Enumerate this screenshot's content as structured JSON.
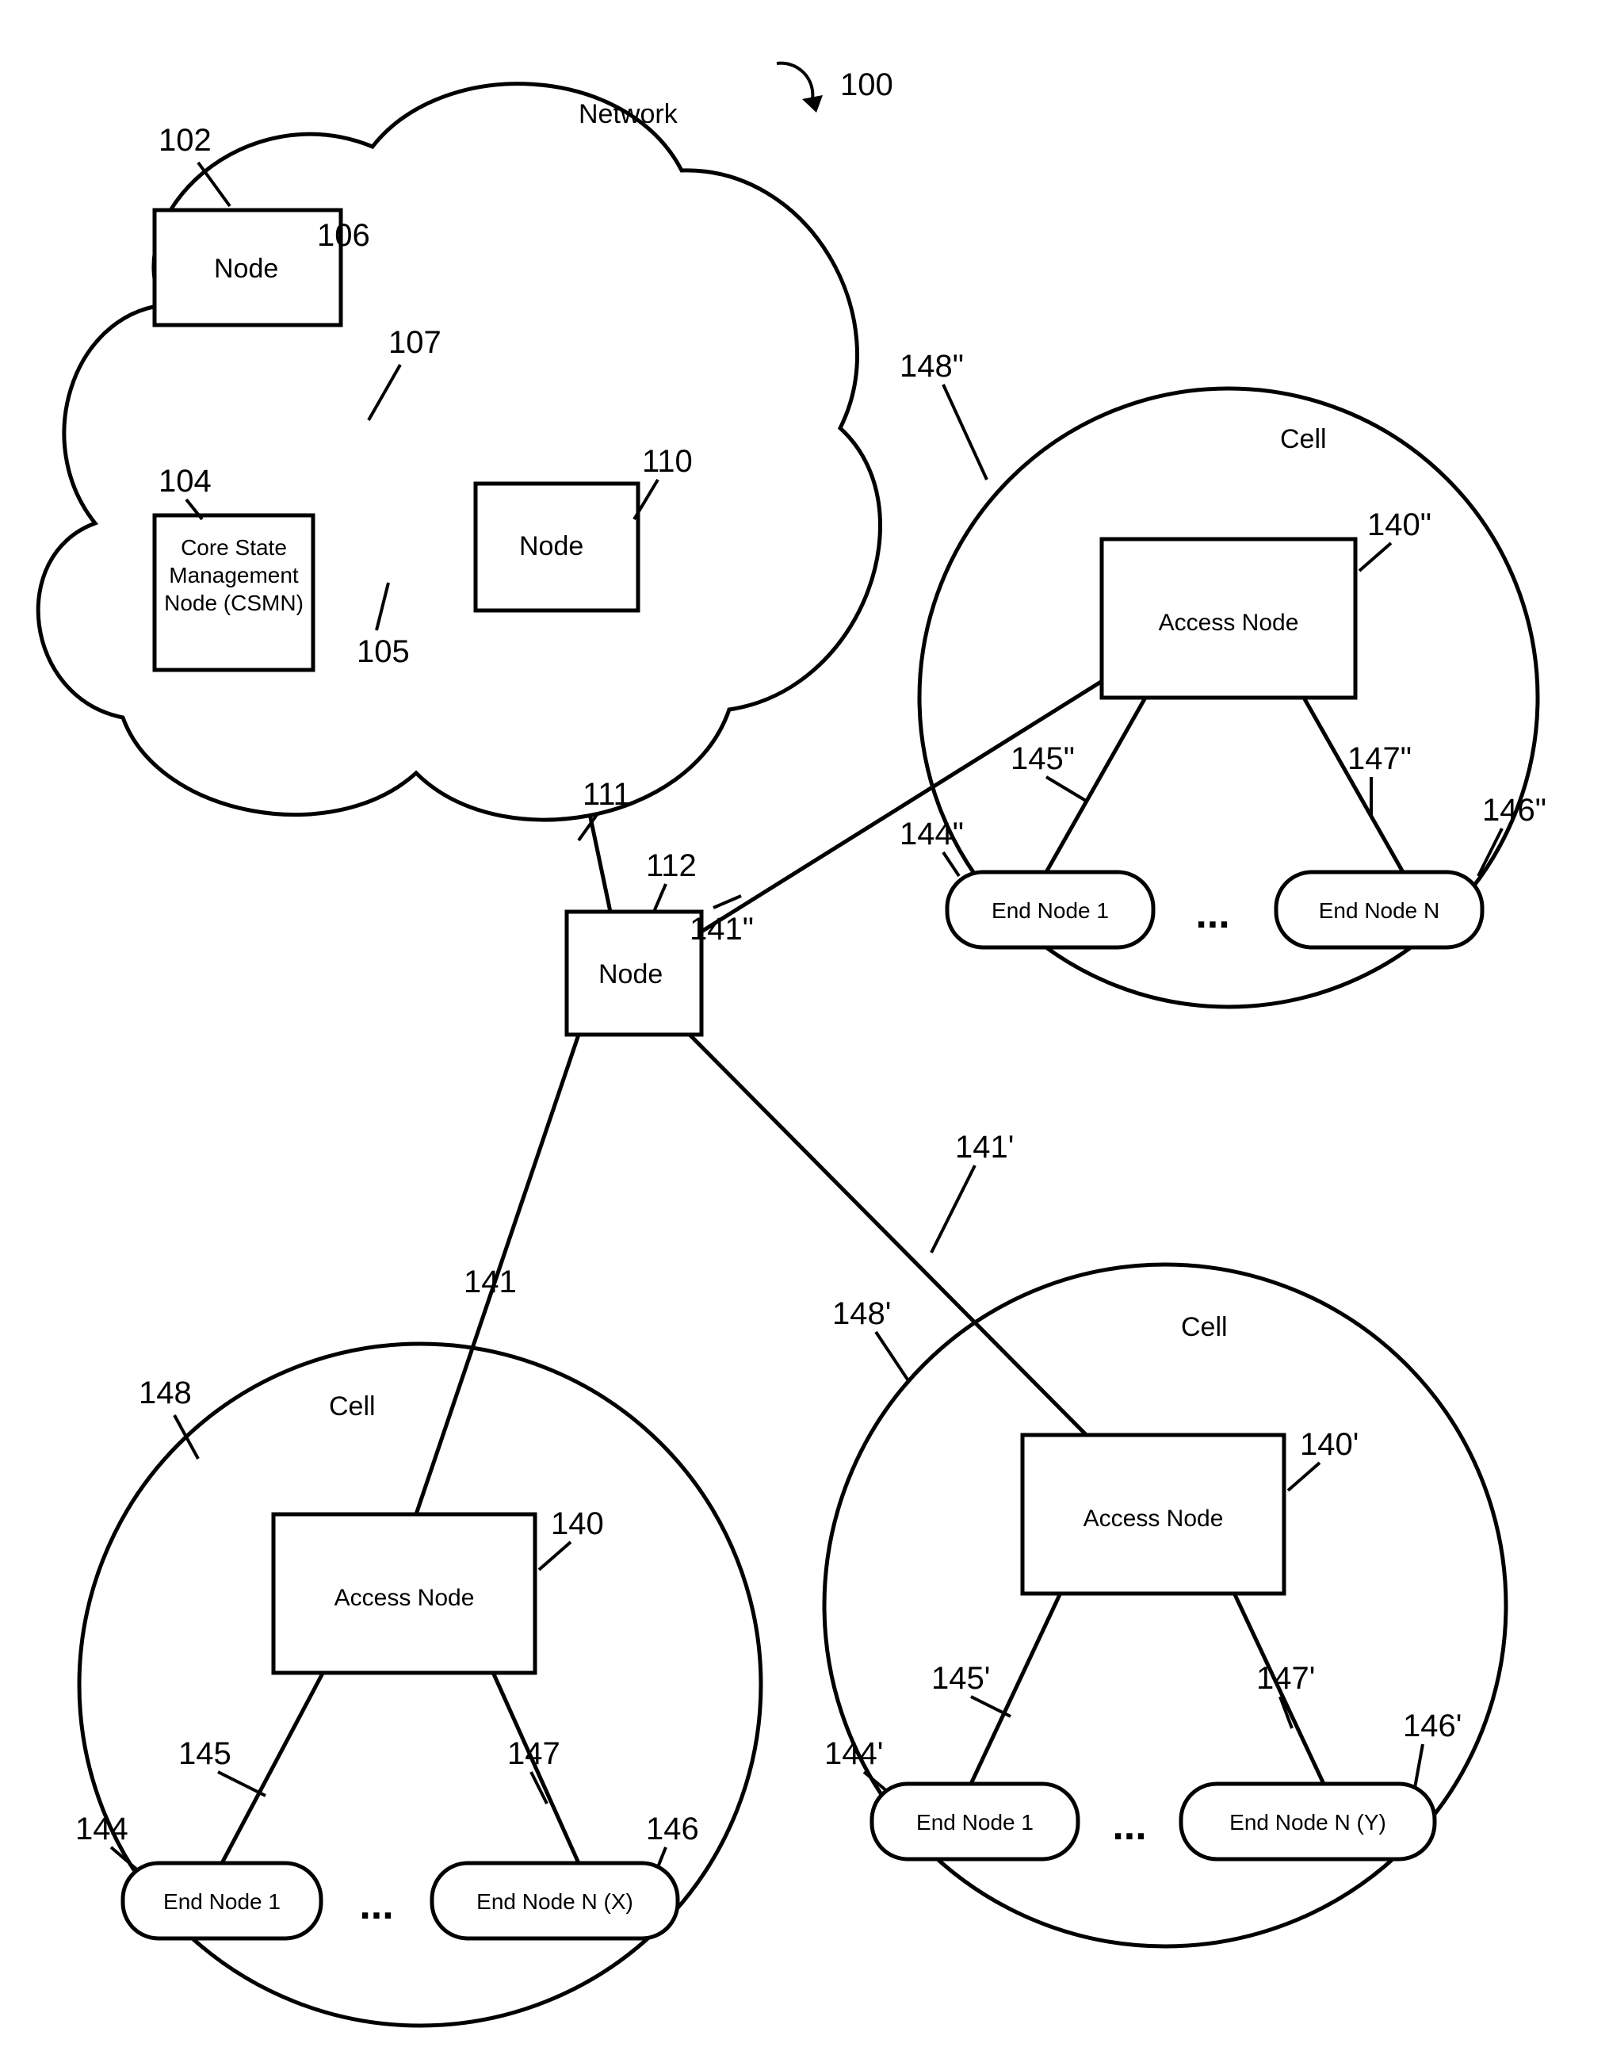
{
  "figure_ref": "100",
  "network": {
    "label": "Network",
    "nodes": {
      "node_top": {
        "label": "Node",
        "ref": "102",
        "ref_line": "106"
      },
      "csmn": {
        "label_lines": [
          "Core State",
          "Management",
          "Node (CSMN)"
        ],
        "ref": "104"
      },
      "node_mid": {
        "label": "Node",
        "ref": "110",
        "link_top": "107",
        "link_csmn": "105"
      },
      "node_gateway": {
        "label": "Node",
        "ref": "112",
        "link_up": "111"
      }
    }
  },
  "cells": [
    {
      "ref": "148",
      "label": "Cell",
      "access_node": {
        "label": "Access Node",
        "ref": "140"
      },
      "link_ref": "141",
      "end_nodes": [
        {
          "label": "End Node 1",
          "ref": "144",
          "link_ref": "145"
        },
        {
          "label": "End Node N (X)",
          "ref": "146",
          "link_ref": "147"
        }
      ],
      "ellipsis": "..."
    },
    {
      "ref": "148'",
      "label": "Cell",
      "access_node": {
        "label": "Access Node",
        "ref": "140'"
      },
      "link_ref": "141'",
      "end_nodes": [
        {
          "label": "End Node 1",
          "ref": "144'",
          "link_ref": "145'"
        },
        {
          "label": "End Node N (Y)",
          "ref": "146'",
          "link_ref": "147'"
        }
      ],
      "ellipsis": "..."
    },
    {
      "ref": "148\"",
      "label": "Cell",
      "access_node": {
        "label": "Access Node",
        "ref": "140\""
      },
      "link_ref": "141\"",
      "end_nodes": [
        {
          "label": "End Node 1",
          "ref": "144\"",
          "link_ref": "145\""
        },
        {
          "label": "End Node N",
          "ref": "146\"",
          "link_ref": "147\""
        }
      ],
      "ellipsis": "..."
    }
  ]
}
